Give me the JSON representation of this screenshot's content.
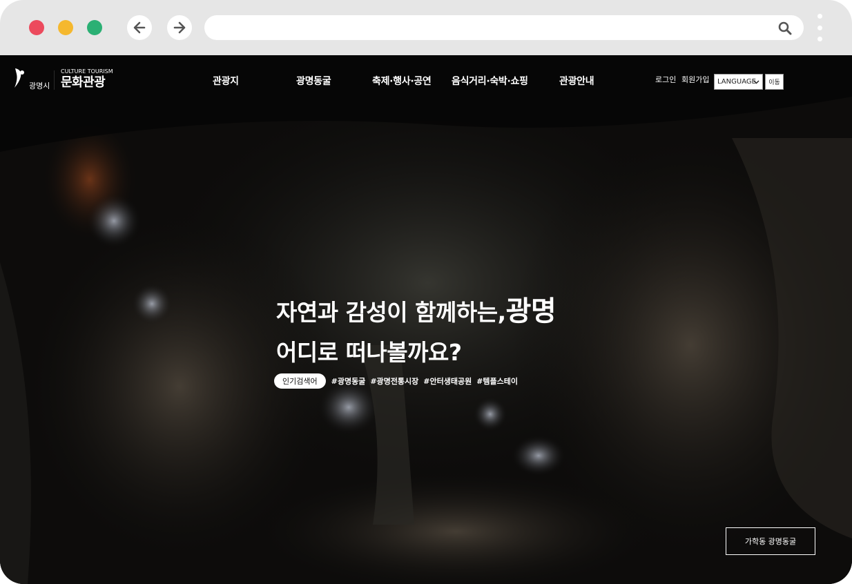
{
  "browser": {
    "address_value": "",
    "icons": {
      "back": "arrow-left-icon",
      "forward": "arrow-right-icon",
      "search": "search-icon",
      "menu": "kebab-menu-icon"
    },
    "colors": {
      "close": "#ec4a5d",
      "minimize": "#f5b82e",
      "maximize": "#2bb074",
      "chrome": "#e6e6e6"
    }
  },
  "site": {
    "logo_city": "광명시",
    "logo_tourism_en": "CULTURE TOURISM",
    "logo_tourism_ko": "문화관광",
    "nav": [
      "관광지",
      "광명동굴",
      "축제·행사·공연",
      "음식거리·숙박·쇼핑",
      "관광안내"
    ],
    "util": {
      "login": "로그인",
      "signup": "회원가입",
      "language": "LANGUAGE",
      "go": "이동"
    }
  },
  "hero": {
    "line1": "자연과 감성이 함께하는,",
    "line1_emphasis": "광명",
    "line2": "어디로 떠나볼까요?",
    "popular_label": "인기검색어",
    "tags": [
      "#광명동굴",
      "#광명전통시장",
      "#안터생태공원",
      "#템플스테이"
    ]
  },
  "location_label": "가학동 광명동굴"
}
